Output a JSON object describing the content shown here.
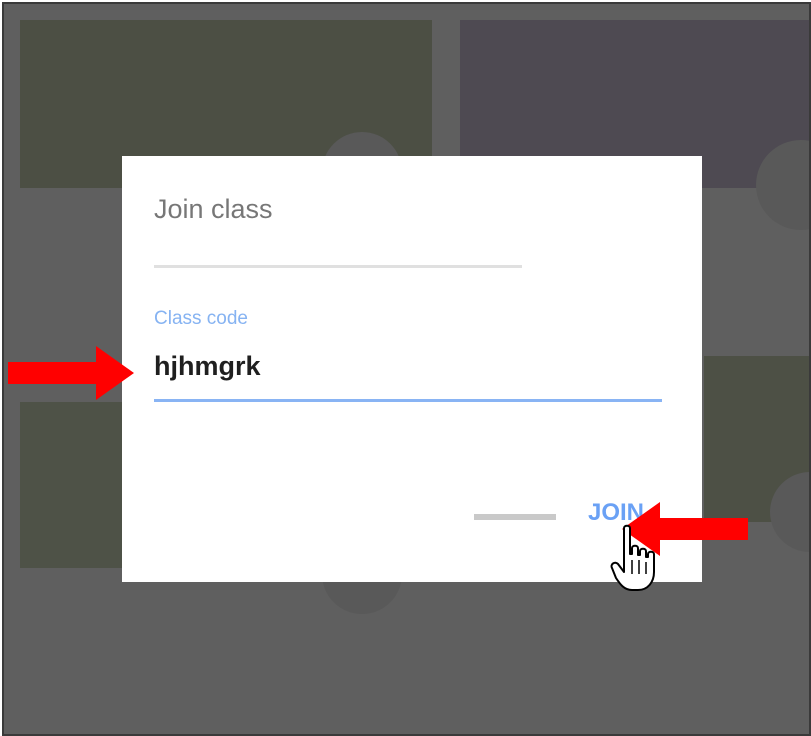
{
  "dialog": {
    "title": "Join class",
    "field": {
      "label": "Class code",
      "value": "hjhmgrk"
    },
    "join_label": "JOIN"
  },
  "colors": {
    "accent": "#6aa1f5",
    "annotation_arrow": "#ff0000",
    "backdrop": "#5f5f5f"
  },
  "icons": {
    "annotation": "red-arrow-icon",
    "cursor": "hand-pointer-icon"
  }
}
